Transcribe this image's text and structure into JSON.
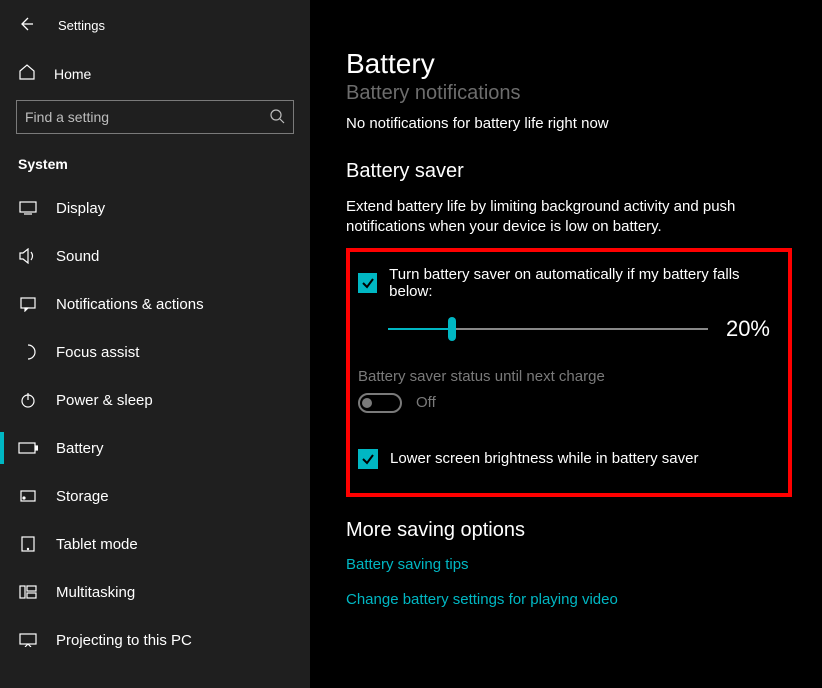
{
  "window": {
    "title": "Settings"
  },
  "sidebar": {
    "home": "Home",
    "search_placeholder": "Find a setting",
    "group_label": "System",
    "items": [
      {
        "label": "Display"
      },
      {
        "label": "Sound"
      },
      {
        "label": "Notifications & actions"
      },
      {
        "label": "Focus assist"
      },
      {
        "label": "Power & sleep"
      },
      {
        "label": "Battery"
      },
      {
        "label": "Storage"
      },
      {
        "label": "Tablet mode"
      },
      {
        "label": "Multitasking"
      },
      {
        "label": "Projecting to this PC"
      }
    ]
  },
  "main": {
    "title": "Battery",
    "cutoff_heading": "Battery notifications",
    "notifications_text": "No notifications for battery life right now",
    "saver_heading": "Battery saver",
    "saver_desc": "Extend battery life by limiting background activity and push notifications when your device is low on battery.",
    "auto_on_label": "Turn battery saver on automatically if my battery falls below:",
    "threshold_percent": "20%",
    "threshold_value": 20,
    "status_label": "Battery saver status until next charge",
    "toggle_state_text": "Off",
    "lower_brightness_label": "Lower screen brightness while in battery saver",
    "more_heading": "More saving options",
    "link_tips": "Battery saving tips",
    "link_video": "Change battery settings for playing video"
  },
  "colors": {
    "accent": "#00b7c3",
    "highlight_border": "#ff0000"
  }
}
